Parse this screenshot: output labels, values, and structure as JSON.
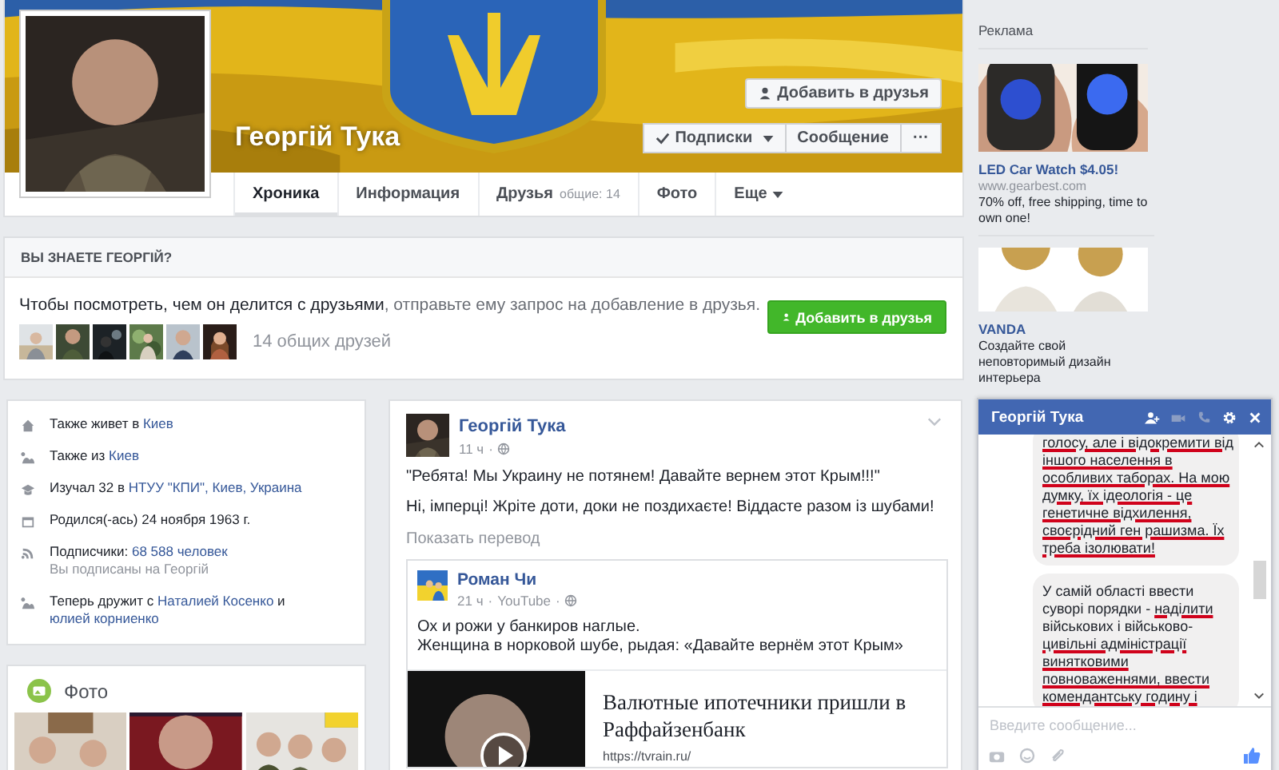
{
  "profile": {
    "name": "Георгій Тука",
    "add_friend": "Добавить в друзья",
    "follow": "Подписки",
    "message": "Сообщение",
    "more": "···"
  },
  "tabs": [
    {
      "label": "Хроника",
      "selected": true
    },
    {
      "label": "Информация",
      "selected": false
    },
    {
      "label": "Друзья",
      "note": "общие: 14",
      "selected": false
    },
    {
      "label": "Фото",
      "selected": false
    },
    {
      "label": "Еще",
      "selected": false
    }
  ],
  "know_card": {
    "title": "ВЫ ЗНАЕТЕ ГЕОРГІЙ?",
    "lead": "Чтобы посмотреть, чем он делится с друзьями",
    "rest": ", отправьте ему запрос на добавление в друзья.",
    "button": "Добавить в друзья",
    "mutual_count": "14 общих друзей"
  },
  "intro": [
    {
      "parts": [
        {
          "text": "Также живет в ",
          "link": false
        },
        {
          "text": "Киев",
          "link": true
        }
      ]
    },
    {
      "parts": [
        {
          "text": "Также из ",
          "link": false
        },
        {
          "text": "Киев",
          "link": true
        }
      ]
    },
    {
      "parts": [
        {
          "text": "Изучал 32 в ",
          "link": false
        },
        {
          "text": "НТУУ \"КПИ\", Киев, Украина",
          "link": true
        }
      ]
    },
    {
      "parts": [
        {
          "text": "Родился(-ась) 24 ноября 1963 г.",
          "link": false
        }
      ]
    },
    {
      "parts": [
        {
          "text": "Подписчики: ",
          "link": false
        },
        {
          "text": "68 588 человек",
          "link": true
        }
      ],
      "sub": "Вы подписаны на Георгій"
    },
    {
      "parts": [
        {
          "text": "Теперь дружит с ",
          "link": false
        },
        {
          "text": "Наталией Косенко",
          "link": true
        },
        {
          "text": " и ",
          "link": false
        },
        {
          "text": "юлией корниенко",
          "link": true
        }
      ]
    }
  ],
  "photos": {
    "title": "Фото"
  },
  "post": {
    "author": "Георгій Тука",
    "time": "11 ч",
    "separator": "·",
    "lines": [
      "\"Ребята! Мы Украину не потянем! Давайте вернем этот Крым!!!\"",
      "Ні, імперці! Жріте доти, доки не поздихаєте! Віддасте разом із шубами!"
    ],
    "translate": "Показать перевод",
    "shared": {
      "author": "Роман Чи",
      "time": "21 ч",
      "separator": "·",
      "source": "YouTube",
      "lines": [
        "Ох и рожи у банкиров наглые.",
        "Женщина в норковой шубе, рыдая: «Давайте вернём этот Крым»"
      ],
      "link_title": "Валютные ипотечники пришли в Раффайзенбанк",
      "link_url": "https://tvrain.ru/"
    }
  },
  "ads": {
    "label": "Реклама",
    "items": [
      {
        "title": "LED Car Watch $4.05!",
        "domain": "www.gearbest.com",
        "text": "70% off, free shipping, time to own one!"
      },
      {
        "title": "VANDA",
        "text": "Создайте свой неповторимый дизайн интерьера"
      }
    ]
  },
  "chat": {
    "title": "Георгій Тука",
    "placeholder": "Введите сообщение...",
    "messages": [
      {
        "lines": [
          [
            {
              "text": "голосу, але і відокремити від",
              "underlined": true
            }
          ],
          [
            {
              "text": "іншого населення в",
              "underlined": true
            }
          ],
          [
            {
              "text": "особливих таборах. На мою",
              "underlined": true
            }
          ],
          [
            {
              "text": "думку, їх ідеологія - це",
              "underlined": true
            }
          ],
          [
            {
              "text": "генетичне відхилення,",
              "underlined": true
            }
          ],
          [
            {
              "text": "своєрідний ген рашизма. Їх",
              "underlined": true
            }
          ],
          [
            {
              "text": "треба ізолювати!",
              "underlined": true
            }
          ]
        ]
      },
      {
        "lines": [
          [
            {
              "text": "У самій області ввести",
              "underlined": false
            }
          ],
          [
            {
              "text": "суворі порядки - ",
              "underlined": false
            },
            {
              "text": "наділити",
              "underlined": true
            }
          ],
          [
            {
              "text": "військових і військово-",
              "underlined": false
            }
          ],
          [
            {
              "text": "цивільні адміністрації",
              "underlined": true
            }
          ],
          [
            {
              "text": "винятковими",
              "underlined": true
            }
          ],
          [
            {
              "text": "повноваженнями, ввести",
              "underlined": true
            }
          ],
          [
            {
              "text": "комендантську годину і",
              "underlined": true
            }
          ]
        ]
      }
    ]
  }
}
